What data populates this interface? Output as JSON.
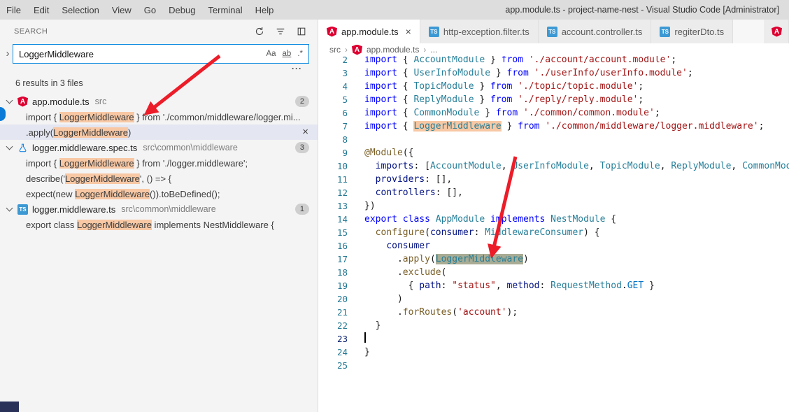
{
  "title_bar": {
    "menus": [
      "File",
      "Edit",
      "Selection",
      "View",
      "Go",
      "Debug",
      "Terminal",
      "Help"
    ],
    "title": "app.module.ts - project-name-nest - Visual Studio Code [Administrator]"
  },
  "search": {
    "header": "SEARCH",
    "input_value": "LoggerMiddleware",
    "options": [
      "Aa",
      "ab",
      ".*"
    ],
    "details_toggle": "···",
    "summary": "6 results in 3 files",
    "files": [
      {
        "icon": "angular",
        "name": "app.module.ts",
        "path": "src",
        "badge": "2",
        "matches": [
          {
            "segments": [
              {
                "t": "import { "
              },
              {
                "t": "LoggerMiddleware",
                "hl": true
              },
              {
                "t": " } from './common/middleware/logger.mi..."
              }
            ]
          },
          {
            "segments": [
              {
                "t": ".apply("
              },
              {
                "t": "LoggerMiddleware",
                "hl": true
              },
              {
                "t": ")"
              }
            ],
            "selected": true,
            "close": "×"
          }
        ]
      },
      {
        "icon": "spec",
        "name": "logger.middleware.spec.ts",
        "path": "src\\common\\middleware",
        "badge": "3",
        "matches": [
          {
            "segments": [
              {
                "t": "import { "
              },
              {
                "t": "LoggerMiddleware",
                "hl": true
              },
              {
                "t": " } from './logger.middleware';"
              }
            ]
          },
          {
            "segments": [
              {
                "t": "describe('"
              },
              {
                "t": "LoggerMiddleware",
                "hl": true
              },
              {
                "t": "', () => {"
              }
            ]
          },
          {
            "segments": [
              {
                "t": "expect(new "
              },
              {
                "t": "LoggerMiddleware",
                "hl": true
              },
              {
                "t": "()).toBeDefined();"
              }
            ]
          }
        ]
      },
      {
        "icon": "ts",
        "name": "logger.middleware.ts",
        "path": "src\\common\\middleware",
        "badge": "1",
        "matches": [
          {
            "segments": [
              {
                "t": "export class "
              },
              {
                "t": "LoggerMiddleware",
                "hl": true
              },
              {
                "t": " implements NestMiddleware {"
              }
            ]
          }
        ]
      }
    ]
  },
  "editor": {
    "tabs": [
      {
        "label": "app.module.ts",
        "icon": "angular",
        "active": true,
        "close": "×"
      },
      {
        "label": "http-exception.filter.ts",
        "icon": "ts"
      },
      {
        "label": "account.controller.ts",
        "icon": "ts"
      },
      {
        "label": "regiterDto.ts",
        "icon": "ts"
      },
      {
        "label": "",
        "icon": "angular",
        "partial": true
      }
    ],
    "breadcrumb": {
      "separator": "›",
      "items": [
        {
          "label": "src"
        },
        {
          "label": "app.module.ts",
          "icon": "angular"
        },
        {
          "label": "..."
        }
      ]
    },
    "lines": [
      {
        "num": "2",
        "tokens": [
          [
            "kw",
            "import"
          ],
          [
            "pl",
            " { "
          ],
          [
            "ty",
            "AccountModule"
          ],
          [
            "pl",
            " } "
          ],
          [
            "kw",
            "from"
          ],
          [
            "pl",
            " "
          ],
          [
            "st",
            "'./account/account.module'"
          ],
          [
            "pl",
            ";"
          ]
        ]
      },
      {
        "num": "3",
        "tokens": [
          [
            "kw",
            "import"
          ],
          [
            "pl",
            " { "
          ],
          [
            "ty",
            "UserInfoModule"
          ],
          [
            "pl",
            " } "
          ],
          [
            "kw",
            "from"
          ],
          [
            "pl",
            " "
          ],
          [
            "st",
            "'./userInfo/userInfo.module'"
          ],
          [
            "pl",
            ";"
          ]
        ]
      },
      {
        "num": "4",
        "tokens": [
          [
            "kw",
            "import"
          ],
          [
            "pl",
            " { "
          ],
          [
            "ty",
            "TopicModule"
          ],
          [
            "pl",
            " } "
          ],
          [
            "kw",
            "from"
          ],
          [
            "pl",
            " "
          ],
          [
            "st",
            "'./topic/topic.module'"
          ],
          [
            "pl",
            ";"
          ]
        ]
      },
      {
        "num": "5",
        "tokens": [
          [
            "kw",
            "import"
          ],
          [
            "pl",
            " { "
          ],
          [
            "ty",
            "ReplyModule"
          ],
          [
            "pl",
            " } "
          ],
          [
            "kw",
            "from"
          ],
          [
            "pl",
            " "
          ],
          [
            "st",
            "'./reply/reply.module'"
          ],
          [
            "pl",
            ";"
          ]
        ]
      },
      {
        "num": "6",
        "tokens": [
          [
            "kw",
            "import"
          ],
          [
            "pl",
            " { "
          ],
          [
            "ty",
            "CommonModule"
          ],
          [
            "pl",
            " } "
          ],
          [
            "kw",
            "from"
          ],
          [
            "pl",
            " "
          ],
          [
            "st",
            "'./common/common.module'"
          ],
          [
            "pl",
            ";"
          ]
        ]
      },
      {
        "num": "7",
        "tokens": [
          [
            "kw",
            "import"
          ],
          [
            "pl",
            " { "
          ],
          [
            "ty",
            "LoggerMiddleware",
            "find"
          ],
          [
            "pl",
            " } "
          ],
          [
            "kw",
            "from"
          ],
          [
            "pl",
            " "
          ],
          [
            "st",
            "'./common/middleware/logger.middleware'"
          ],
          [
            "pl",
            ";"
          ]
        ]
      },
      {
        "num": "8",
        "tokens": []
      },
      {
        "num": "9",
        "tokens": [
          [
            "fn",
            "@Module"
          ],
          [
            "pl",
            "({"
          ]
        ]
      },
      {
        "num": "10",
        "tokens": [
          [
            "pl",
            "  "
          ],
          [
            "pr",
            "imports"
          ],
          [
            "pl",
            ": ["
          ],
          [
            "ty",
            "AccountModule"
          ],
          [
            "pl",
            ", "
          ],
          [
            "ty",
            "UserInfoModule"
          ],
          [
            "pl",
            ", "
          ],
          [
            "ty",
            "TopicModule"
          ],
          [
            "pl",
            ", "
          ],
          [
            "ty",
            "ReplyModule"
          ],
          [
            "pl",
            ", "
          ],
          [
            "ty",
            "CommonModule"
          ],
          [
            "pl",
            "],"
          ]
        ]
      },
      {
        "num": "11",
        "tokens": [
          [
            "pl",
            "  "
          ],
          [
            "pr",
            "providers"
          ],
          [
            "pl",
            ": [],"
          ]
        ]
      },
      {
        "num": "12",
        "tokens": [
          [
            "pl",
            "  "
          ],
          [
            "pr",
            "controllers"
          ],
          [
            "pl",
            ": [],"
          ]
        ]
      },
      {
        "num": "13",
        "tokens": [
          [
            "pl",
            "})"
          ]
        ]
      },
      {
        "num": "14",
        "tokens": [
          [
            "kw",
            "export"
          ],
          [
            "pl",
            " "
          ],
          [
            "kw",
            "class"
          ],
          [
            "pl",
            " "
          ],
          [
            "ty",
            "AppModule"
          ],
          [
            "pl",
            " "
          ],
          [
            "kw",
            "implements"
          ],
          [
            "pl",
            " "
          ],
          [
            "ty",
            "NestModule"
          ],
          [
            "pl",
            " {"
          ]
        ]
      },
      {
        "num": "15",
        "tokens": [
          [
            "pl",
            "  "
          ],
          [
            "fn",
            "configure"
          ],
          [
            "pl",
            "("
          ],
          [
            "pr",
            "consumer"
          ],
          [
            "pl",
            ": "
          ],
          [
            "ty",
            "MiddlewareConsumer"
          ],
          [
            "pl",
            ") {"
          ]
        ]
      },
      {
        "num": "16",
        "tokens": [
          [
            "pl",
            "    "
          ],
          [
            "pr",
            "consumer"
          ]
        ]
      },
      {
        "num": "17",
        "tokens": [
          [
            "pl",
            "      ."
          ],
          [
            "fn",
            "apply"
          ],
          [
            "pl",
            "("
          ],
          [
            "ty",
            "LoggerMiddleware",
            "cur"
          ],
          [
            "pl",
            ")"
          ]
        ]
      },
      {
        "num": "18",
        "tokens": [
          [
            "pl",
            "      ."
          ],
          [
            "fn",
            "exclude"
          ],
          [
            "pl",
            "("
          ]
        ]
      },
      {
        "num": "19",
        "tokens": [
          [
            "pl",
            "        { "
          ],
          [
            "pr",
            "path"
          ],
          [
            "pl",
            ": "
          ],
          [
            "st",
            "\"status\""
          ],
          [
            "pl",
            ", "
          ],
          [
            "pr",
            "method"
          ],
          [
            "pl",
            ": "
          ],
          [
            "ty",
            "RequestMethod"
          ],
          [
            "pl",
            "."
          ],
          [
            "cn",
            "GET"
          ],
          [
            "pl",
            " }"
          ]
        ]
      },
      {
        "num": "20",
        "tokens": [
          [
            "pl",
            "      )"
          ]
        ]
      },
      {
        "num": "21",
        "tokens": [
          [
            "pl",
            "      ."
          ],
          [
            "fn",
            "forRoutes"
          ],
          [
            "pl",
            "("
          ],
          [
            "st",
            "'account'"
          ],
          [
            "pl",
            ");"
          ]
        ]
      },
      {
        "num": "22",
        "tokens": [
          [
            "pl",
            "  }"
          ]
        ]
      },
      {
        "num": "23",
        "tokens": [],
        "cursor": true,
        "active": true
      },
      {
        "num": "24",
        "tokens": [
          [
            "pl",
            "}"
          ]
        ]
      },
      {
        "num": "25",
        "tokens": []
      }
    ]
  },
  "colors": {
    "accent": "#0e8ae0",
    "find_match_highlight": "#f8c8a4",
    "current_match_highlight": "#a9ac94",
    "annotation_arrow": "#ec1c28",
    "angular_icon": "#dd0031",
    "typescript_icon": "#3c99d4"
  }
}
